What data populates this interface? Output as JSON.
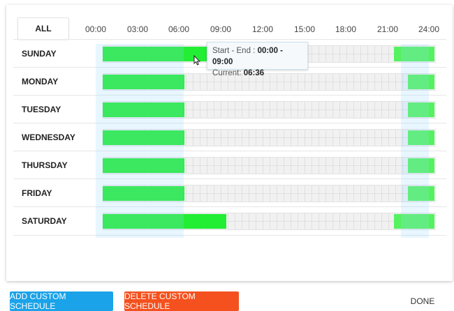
{
  "header": {
    "all_label": "ALL",
    "hours": [
      "00:00",
      "03:00",
      "06:00",
      "09:00",
      "12:00",
      "15:00",
      "18:00",
      "21:00",
      "24:00"
    ]
  },
  "schedule": {
    "days": [
      {
        "label": "SUNDAY",
        "ranges": [
          [
            "00:00",
            "09:00"
          ],
          [
            "21:00",
            "24:00"
          ]
        ]
      },
      {
        "label": "MONDAY",
        "ranges": [
          [
            "00:00",
            "06:00"
          ],
          [
            "22:00",
            "24:00"
          ]
        ]
      },
      {
        "label": "TUESDAY",
        "ranges": [
          [
            "00:00",
            "06:00"
          ],
          [
            "22:00",
            "24:00"
          ]
        ]
      },
      {
        "label": "WEDNESDAY",
        "ranges": [
          [
            "00:00",
            "06:00"
          ],
          [
            "22:00",
            "24:00"
          ]
        ]
      },
      {
        "label": "THURSDAY",
        "ranges": [
          [
            "00:00",
            "06:00"
          ],
          [
            "22:00",
            "24:00"
          ]
        ]
      },
      {
        "label": "FRIDAY",
        "ranges": [
          [
            "00:00",
            "06:00"
          ],
          [
            "22:00",
            "24:00"
          ]
        ]
      },
      {
        "label": "SATURDAY",
        "ranges": [
          [
            "00:00",
            "09:00"
          ],
          [
            "21:00",
            "24:00"
          ]
        ]
      }
    ]
  },
  "tooltip": {
    "range_label": "Start - End :",
    "range_value": "00:00 - 09:00",
    "current_label": "Current:",
    "current_value": "06:36"
  },
  "actions": {
    "add_label": "ADD CUSTOM SCHEDULE",
    "delete_label": "DELETE CUSTOM SCHEDULE",
    "done_label": "DONE"
  },
  "colors": {
    "segment": "#22ee33",
    "segment_light": "#55f25f",
    "add_button": "#1aa3e8",
    "delete_button": "#f4511e"
  }
}
